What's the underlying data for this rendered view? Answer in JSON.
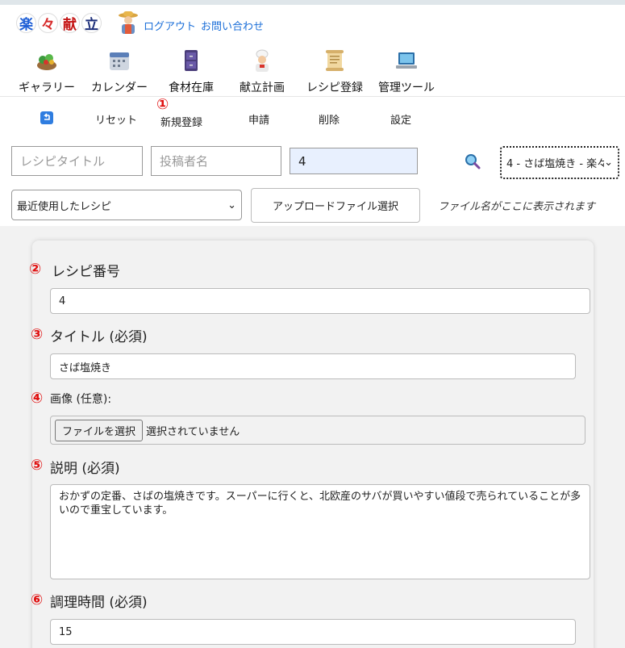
{
  "header": {
    "logo_chars": [
      "楽",
      "々",
      "献",
      "立"
    ],
    "logout_label": "ログアウト",
    "contact_label": "お問い合わせ"
  },
  "nav": [
    {
      "label": "ギャラリー",
      "icon": "salad-bowl-icon"
    },
    {
      "label": "カレンダー",
      "icon": "calendar-icon"
    },
    {
      "label": "食材在庫",
      "icon": "cabinet-icon"
    },
    {
      "label": "献立計画",
      "icon": "chef-icon"
    },
    {
      "label": "レシピ登録",
      "icon": "scroll-icon"
    },
    {
      "label": "管理ツール",
      "icon": "laptop-icon"
    }
  ],
  "toolbar": {
    "back_icon": "return-arrow-icon",
    "reset": "リセット",
    "new_register": "新規登録",
    "apply": "申請",
    "delete": "削除",
    "settings": "設定"
  },
  "markers": [
    "①",
    "②",
    "③",
    "④",
    "⑤",
    "⑥"
  ],
  "search": {
    "title_placeholder": "レシピタイトル",
    "author_placeholder": "投稿者名",
    "number_value": "4",
    "recipe_select": "4 - さば塩焼き - 楽々",
    "recent_select": "最近使用したレシピ",
    "upload_button": "アップロードファイル選択",
    "file_name_placeholder": "ファイル名がここに表示されます"
  },
  "form": {
    "recipe_number_label": "レシピ番号",
    "recipe_number_value": "4",
    "title_label": "タイトル (必須)",
    "title_value": "さば塩焼き",
    "image_label": "画像 (任意):",
    "file_button": "ファイルを選択",
    "file_status": "選択されていません",
    "description_label": "説明 (必須)",
    "description_value": "おかずの定番、さばの塩焼きです。スーパーに行くと、北欧産のサバが買いやすい値段で売られていることが多いので重宝しています。",
    "cook_time_label": "調理時間 (必須)",
    "cook_time_value": "15"
  }
}
